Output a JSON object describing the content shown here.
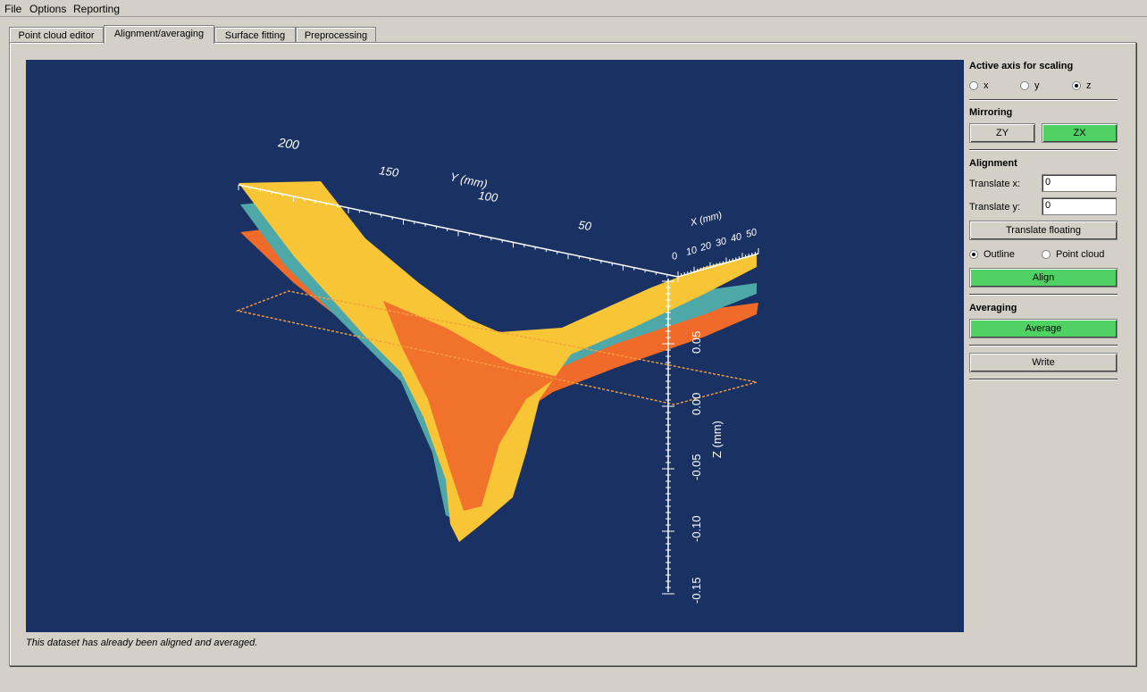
{
  "menu": {
    "file": "File",
    "options": "Options",
    "reporting": "Reporting"
  },
  "tabs": [
    "Point cloud editor",
    "Alignment/averaging",
    "Surface fitting",
    "Preprocessing"
  ],
  "active_tab": "Alignment/averaging",
  "plot": {
    "y_axis_label": "Y (mm)",
    "y_ticks": [
      "200",
      "150",
      "100",
      "50"
    ],
    "x_axis_label": "X (mm)",
    "x_ticks": [
      "0",
      "10",
      "20",
      "30",
      "40",
      "50"
    ],
    "z_axis_label": "Z (mm)",
    "z_ticks": [
      "0.05",
      "0.00",
      "-0.05",
      "-0.10",
      "-0.15"
    ],
    "colors": {
      "background": "#1a3263",
      "series_yellow": "#f7c535",
      "series_teal": "#4fa8a8",
      "series_orange": "#f06a2a"
    }
  },
  "status_text": "This dataset has already been aligned and averaged.",
  "sidebar": {
    "scaling_title": "Active axis for scaling",
    "axis_options": [
      "x",
      "y",
      "z"
    ],
    "axis_selected": "z",
    "mirroring_title": "Mirroring",
    "mirror_zy": "ZY",
    "mirror_zx": "ZX",
    "alignment_title": "Alignment",
    "translate_x_label": "Translate x:",
    "translate_x_value": "0",
    "translate_y_label": "Translate y:",
    "translate_y_value": "0",
    "translate_floating": "Translate floating",
    "mode_outline": "Outline",
    "mode_point_cloud": "Point cloud",
    "mode_selected": "Outline",
    "align_button": "Align",
    "averaging_title": "Averaging",
    "average_button": "Average",
    "write_button": "Write"
  }
}
